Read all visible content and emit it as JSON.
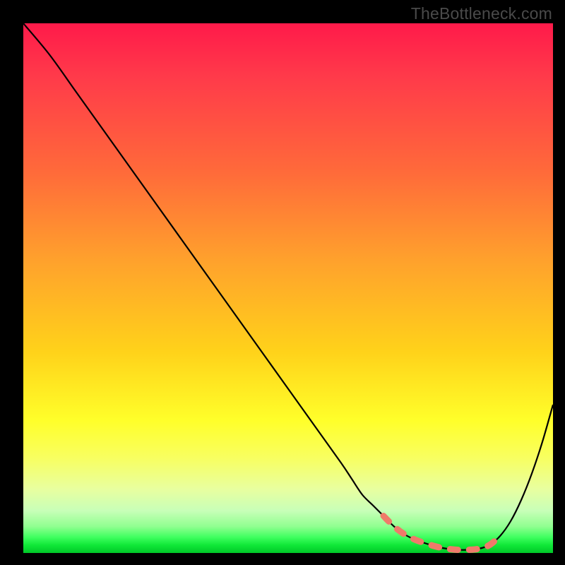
{
  "watermark": "TheBottleneck.com",
  "colors": {
    "curve": "#000000",
    "highlight": "#ef7a6a",
    "frame": "#000000"
  },
  "chart_data": {
    "type": "line",
    "title": "",
    "xlabel": "",
    "ylabel": "",
    "xlim": [
      0,
      100
    ],
    "ylim": [
      0,
      100
    ],
    "grid": false,
    "legend": false,
    "x": [
      0,
      5,
      10,
      15,
      20,
      25,
      30,
      35,
      40,
      45,
      50,
      55,
      60,
      62,
      64,
      66,
      68,
      70,
      72,
      74,
      76,
      78,
      80,
      82,
      84,
      86,
      88,
      90,
      92,
      94,
      96,
      98,
      100
    ],
    "y": [
      100,
      94,
      87,
      80,
      73,
      66,
      59,
      52,
      45,
      38,
      31,
      24,
      17,
      14,
      11,
      9,
      7,
      5,
      3.5,
      2.5,
      1.8,
      1.2,
      0.8,
      0.6,
      0.6,
      0.8,
      1.5,
      3.2,
      6,
      10,
      15,
      21,
      28
    ],
    "highlight_x_range": [
      68,
      91
    ]
  }
}
